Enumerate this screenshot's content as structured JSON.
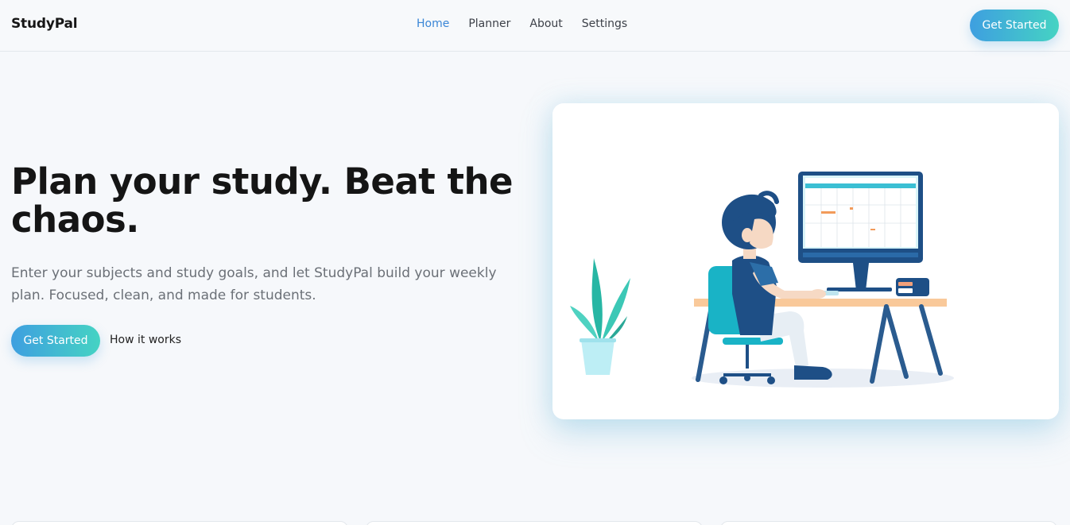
{
  "header": {
    "brand": "StudyPal",
    "nav": [
      {
        "label": "Home",
        "active": true
      },
      {
        "label": "Planner",
        "active": false
      },
      {
        "label": "About",
        "active": false
      },
      {
        "label": "Settings",
        "active": false
      }
    ],
    "cta_label": "Get Started"
  },
  "hero": {
    "title": "Plan your study. Beat the chaos.",
    "subtitle": "Enter your subjects and study goals, and let StudyPal build your weekly plan. Focused, clean, and made for students.",
    "primary_cta": "Get Started",
    "secondary_cta": "How it works"
  },
  "colors": {
    "accent_start": "#3e9fe0",
    "accent_end": "#45d3c3",
    "nav_active": "#3a86d6",
    "background": "#f6f8fb"
  }
}
